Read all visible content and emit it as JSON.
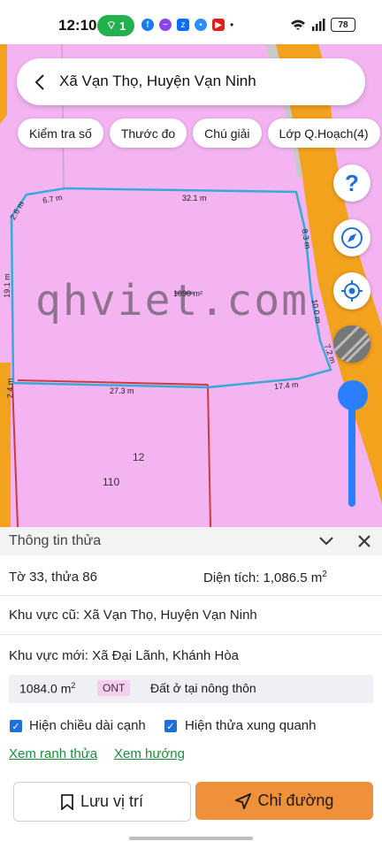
{
  "status_bar": {
    "time": "12:10",
    "pill": "1",
    "battery": "78",
    "app_icons": [
      "facebook-icon",
      "messenger-icon",
      "zalo-icon",
      "messenger-alt-icon",
      "youtube-icon",
      "dot-icon"
    ],
    "colors": {
      "pill": "#23b14d"
    }
  },
  "search": {
    "title": "Xã Vạn Thọ, Huyện Vạn Ninh"
  },
  "chips": {
    "check": "Kiểm tra số",
    "measure": "Thước đo",
    "legend": "Chú giải",
    "layers": "Lớp Q.Hoạch(4)"
  },
  "map": {
    "watermark": "qhviet.com",
    "area_label": "1090 m²",
    "edges": {
      "top": "32.1 m",
      "top_left": "6.7 m",
      "left_top": "2.6 m",
      "left": "19.1 m",
      "left_bottom": "2.4 m",
      "right_top": "8.3 m",
      "right_mid": "10.0 m",
      "right_bottom": "7.2 m",
      "bottom_left": "27.3 m",
      "bottom_right": "17.4 m"
    },
    "parcel_labels": [
      "12",
      "110"
    ],
    "colors": {
      "residential": "#f4b4f2",
      "road": "#f2a21d",
      "parcel_edge": "#3aa9d8"
    }
  },
  "fabs": [
    "help-icon",
    "compass-icon",
    "locate-icon",
    "satellite-icon"
  ],
  "panel": {
    "title": "Thông tin thửa",
    "sheet_parcel": "Tờ 33, thửa 86",
    "area_label": "Diện tích: 1,086.5 m",
    "area_sup": "2",
    "old_region": "Khu vực cũ: Xã Vạn Thọ, Huyện Vạn Ninh",
    "new_region": "Khu vực mới: Xã Đại Lãnh, Khánh Hòa",
    "land_area": "1084.0 m",
    "land_area_sup": "2",
    "land_code": "ONT",
    "land_type": "Đất ở tại nông thôn",
    "checkbox_edges": "Hiện chiều dài cạnh",
    "checkbox_neighbors": "Hiện thửa xung quanh",
    "link_bounds": "Xem ranh thửa",
    "link_direction": "Xem hướng",
    "btn_save": "Lưu vị trí",
    "btn_route": "Chỉ đường",
    "colors": {
      "route_button": "#f0903a",
      "link": "#1a8f3a"
    }
  }
}
